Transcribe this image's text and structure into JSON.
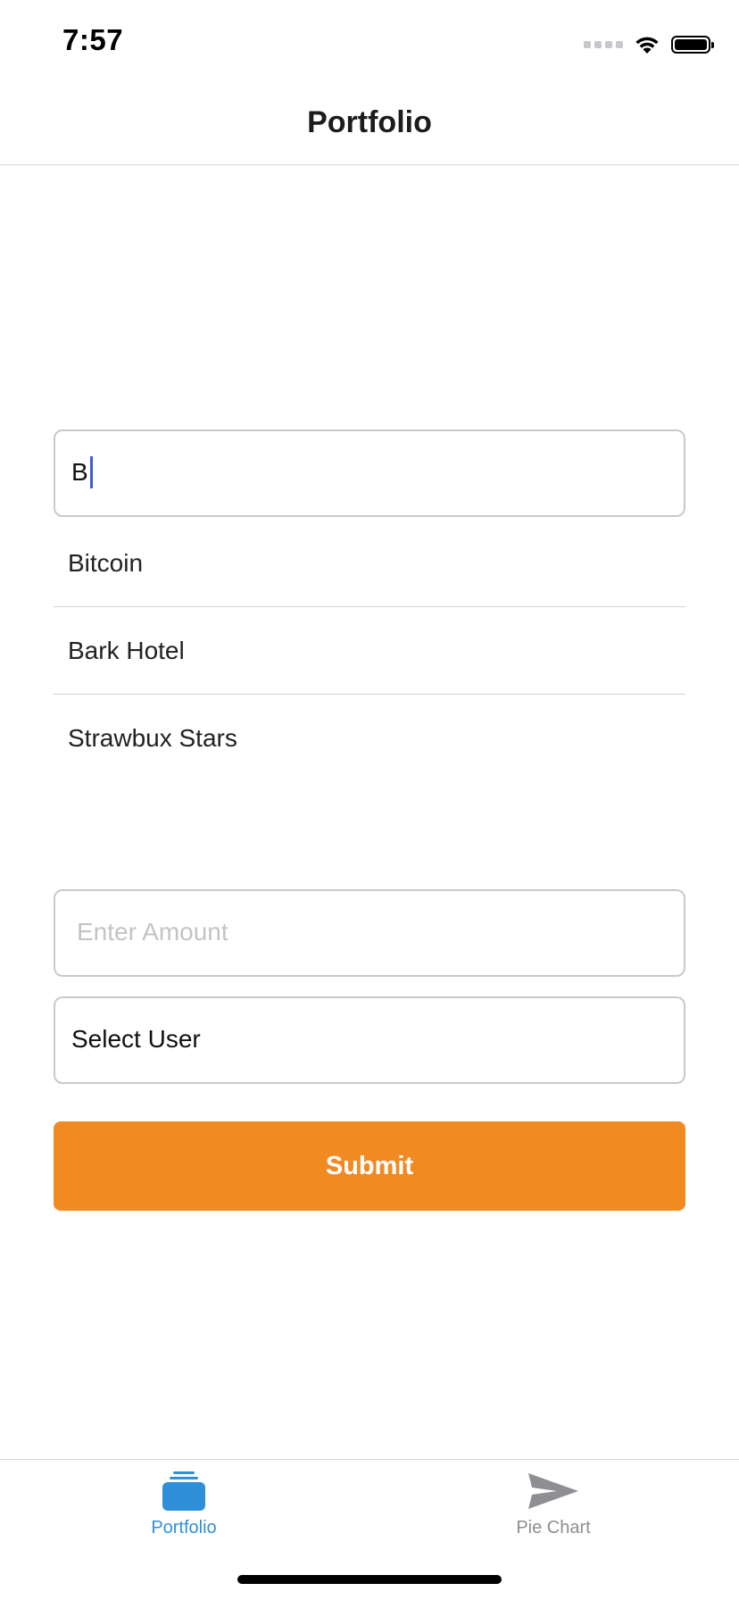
{
  "status_bar": {
    "time": "7:57"
  },
  "nav": {
    "title": "Portfolio"
  },
  "search": {
    "value": "B"
  },
  "suggestions": [
    {
      "label": "Bitcoin"
    },
    {
      "label": "Bark Hotel"
    },
    {
      "label": "Strawbux Stars"
    }
  ],
  "amount": {
    "placeholder": "Enter Amount"
  },
  "user_select": {
    "value": "Select User"
  },
  "submit": {
    "label": "Submit"
  },
  "tabs": [
    {
      "label": "Portfolio",
      "icon": "stack-icon",
      "active": true
    },
    {
      "label": "Pie Chart",
      "icon": "send-icon",
      "active": false
    }
  ],
  "colors": {
    "accent": "#f28a22",
    "tab_active": "#2e8fd8",
    "tab_inactive": "#8e8e93",
    "caret": "#3b5bdb"
  }
}
